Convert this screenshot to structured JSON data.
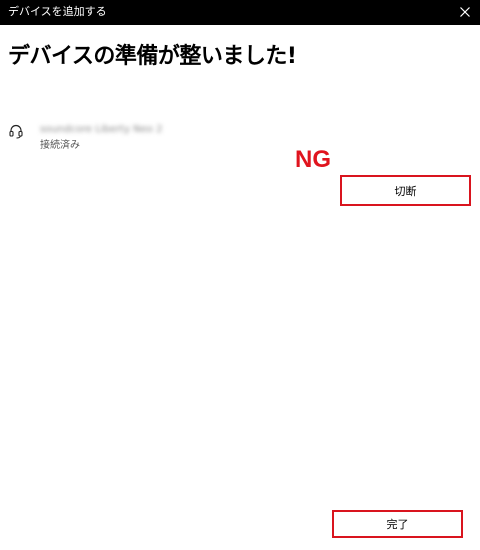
{
  "window": {
    "title": "デバイスを追加する",
    "close_icon": "close-icon"
  },
  "main": {
    "heading": "デバイスの準備が整いました!",
    "device": {
      "icon": "headset-icon",
      "name": "soundcore Liberty Neo 2",
      "status": "接続済み"
    },
    "annotation": {
      "text": "NG",
      "color": "#e0141e"
    },
    "disconnect_label": "切断"
  },
  "footer": {
    "done_label": "完了"
  },
  "colors": {
    "titlebar_bg": "#000000",
    "highlight_border": "#d9141e"
  }
}
